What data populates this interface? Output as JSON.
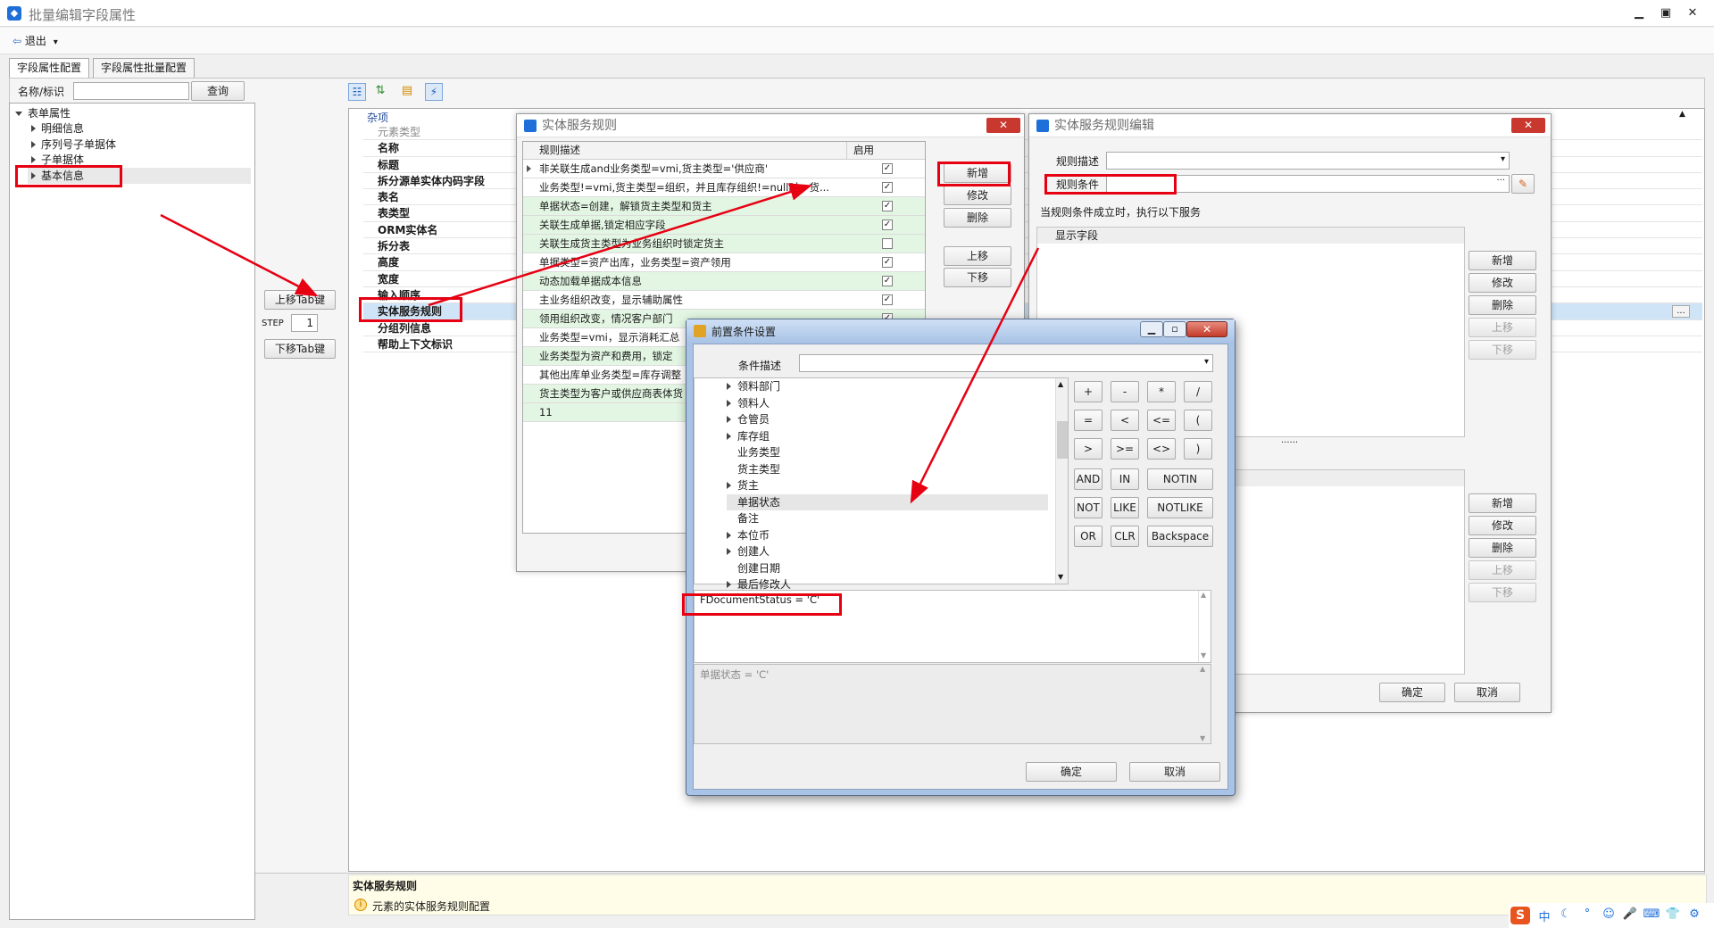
{
  "window": {
    "title": "批量编辑字段属性"
  },
  "toolbar": {
    "exit_label": "退出"
  },
  "tabs": [
    {
      "label": "字段属性配置"
    },
    {
      "label": "字段属性批量配置"
    }
  ],
  "search": {
    "label": "名称/标识",
    "button": "查询",
    "value": ""
  },
  "tree": {
    "root": "表单属性",
    "items": [
      {
        "label": "明细信息"
      },
      {
        "label": "序列号子单据体"
      },
      {
        "label": "子单据体"
      },
      {
        "label": "基本信息"
      }
    ]
  },
  "tab_controls": {
    "up": "上移Tab键",
    "step_label": "STEP",
    "step_value": "1",
    "down": "下移Tab键"
  },
  "property_grid": {
    "category": "杂项",
    "rows": [
      "元素类型",
      "名称",
      "标题",
      "拆分源单实体内码字段",
      "表名",
      "表类型",
      "ORM实体名",
      "拆分表",
      "高度",
      "宽度",
      "输入顺序",
      "实体服务规则",
      "分组列信息",
      "帮助上下文标识"
    ],
    "ellipsis": "..."
  },
  "rules_dialog": {
    "title": "实体服务规则",
    "close": "✕",
    "columns": {
      "desc": "规则描述",
      "enabled": "启用"
    },
    "rows": [
      {
        "desc": "非关联生成and业务类型=vmi,货主类型='供应商'",
        "enabled": "✓"
      },
      {
        "desc": "业务类型!=vmi,货主类型=组织，并且库存组织!=null时，货...",
        "enabled": "✓"
      },
      {
        "desc": "单据状态=创建，解锁货主类型和货主",
        "enabled": "✓"
      },
      {
        "desc": "关联生成单据,锁定相应字段",
        "enabled": "✓"
      },
      {
        "desc": "关联生成货主类型为业务组织时锁定货主",
        "enabled": ""
      },
      {
        "desc": "单据类型=资产出库，业务类型=资产领用",
        "enabled": "✓"
      },
      {
        "desc": "动态加载单据成本信息",
        "enabled": "✓"
      },
      {
        "desc": "主业务组织改变，显示辅助属性",
        "enabled": "✓"
      },
      {
        "desc": "领用组织改变，情况客户部门",
        "enabled": "✓"
      },
      {
        "desc": "业务类型=vmi，显示消耗汇总",
        "enabled": ""
      },
      {
        "desc": "业务类型为资产和费用，锁定",
        "enabled": ""
      },
      {
        "desc": "其他出库单业务类型=库存调整",
        "enabled": ""
      },
      {
        "desc": "货主类型为客户或供应商表体货",
        "enabled": ""
      },
      {
        "desc": "11",
        "enabled": ""
      }
    ],
    "buttons": {
      "add": "新增",
      "edit": "修改",
      "delete": "删除",
      "up": "上移",
      "down": "下移"
    }
  },
  "edit_dialog": {
    "title": "实体服务规则编辑",
    "close": "✕",
    "desc_label": "规则描述",
    "cond_label": "规则条件",
    "desc_value": "",
    "cond_value": "",
    "hint": "当规则条件成立时，执行以下服务",
    "list_header": "显示字段",
    "buttons1": {
      "add": "新增",
      "edit": "修改",
      "delete": "删除",
      "up": "上移",
      "down": "下移"
    },
    "buttons2": {
      "add": "新增",
      "edit": "修改",
      "delete": "删除",
      "up": "上移",
      "down": "下移"
    },
    "splitter": "......",
    "ok": "确定",
    "cancel": "取消"
  },
  "cond_dialog": {
    "title": "前置条件设置",
    "desc_label": "条件描述",
    "desc_value": "",
    "fields": [
      {
        "label": "领料部门",
        "expandable": true
      },
      {
        "label": "领料人",
        "expandable": true
      },
      {
        "label": "仓管员",
        "expandable": true
      },
      {
        "label": "库存组",
        "expandable": true
      },
      {
        "label": "业务类型",
        "expandable": false
      },
      {
        "label": "货主类型",
        "expandable": false
      },
      {
        "label": "货主",
        "expandable": true
      },
      {
        "label": "单据状态",
        "expandable": false
      },
      {
        "label": "备注",
        "expandable": false
      },
      {
        "label": "本位币",
        "expandable": true
      },
      {
        "label": "创建人",
        "expandable": true
      },
      {
        "label": "创建日期",
        "expandable": false
      },
      {
        "label": "最后修改人",
        "expandable": true
      }
    ],
    "keys": [
      [
        "+",
        "-",
        "*",
        "/"
      ],
      [
        "=",
        "<",
        "<=",
        "("
      ],
      [
        ">",
        ">=",
        "<>",
        ")"
      ]
    ],
    "keys2": [
      [
        "AND",
        "IN",
        "NOTIN"
      ],
      [
        "NOT",
        "LIKE",
        "NOTLIKE"
      ],
      [
        "OR",
        "CLR",
        "Backspace"
      ]
    ],
    "expression": "FDocumentStatus  = 'C'",
    "preview": "单据状态  = 'C'",
    "ok": "确定",
    "cancel": "取消"
  },
  "status": {
    "title": "实体服务规则",
    "desc": "元素的实体服务规则配置"
  },
  "tray": {
    "ime": "S",
    "items": [
      "中",
      "☾",
      "°",
      "☺",
      "🎤",
      "⌨",
      "👕",
      "⚙"
    ]
  }
}
